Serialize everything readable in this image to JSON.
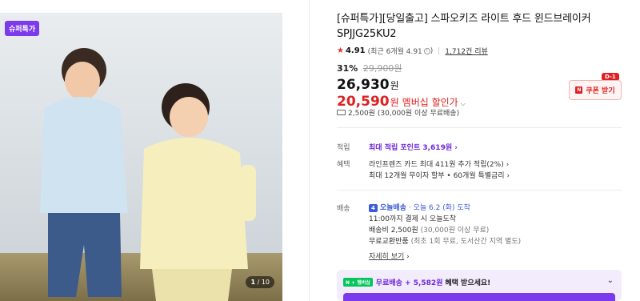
{
  "image": {
    "badge": "슈퍼특가",
    "counter_current": "1",
    "counter_total": "/ 10"
  },
  "product": {
    "title_line1": "[슈퍼특가][당일출고] 스파오키즈 라이트 후드 윈드브레이커",
    "title_line2": "SPJJG25KU2",
    "rating": "4.91",
    "rating_recent": "(최근 6개월 4.91",
    "rating_recent_close": ")",
    "reviews": "1,712건 리뷰",
    "discount": "31%",
    "original_price": "29,900원",
    "price": "26,930",
    "price_unit": "원",
    "member_price": "20,590",
    "member_price_unit": "원",
    "member_label": "멤버십 할인가"
  },
  "coupon": {
    "tag": "D-1",
    "label": "쿠폰 받기",
    "icon": "N"
  },
  "shipping_summary": "2,500원 (30,000원 이상 무료배송)",
  "points": {
    "label": "적립",
    "text": "최대 적립 포인트 3,619원"
  },
  "benefit": {
    "label": "혜택",
    "line1": "라인프렌즈 카드 최대 411원 추가 적립(2%)",
    "line2": "최대 12개월 무이자 할부 • 60개월 특별금리"
  },
  "delivery": {
    "label": "배송",
    "badge": "4",
    "today_label": "오늘배송",
    "today_date": "오늘 6.2 (화) 도착",
    "cutoff": "11:00까지 결제 시 오늘도착",
    "fee": "배송비 2,500원",
    "fee_note": "(30,000원 이상 무료)",
    "return": "무료교환반품",
    "return_note": "(최초 1회 무료, 도서산간 지역 별도)",
    "more": "자세히 보기"
  },
  "banner": {
    "logo": "N + 멤버십",
    "highlight": "무료배송 + 5,582원",
    "text": "혜택 받으세요!"
  },
  "colors": {
    "accent": "#7c3aed",
    "sale": "#e02020",
    "today": "#3b5bdb"
  }
}
